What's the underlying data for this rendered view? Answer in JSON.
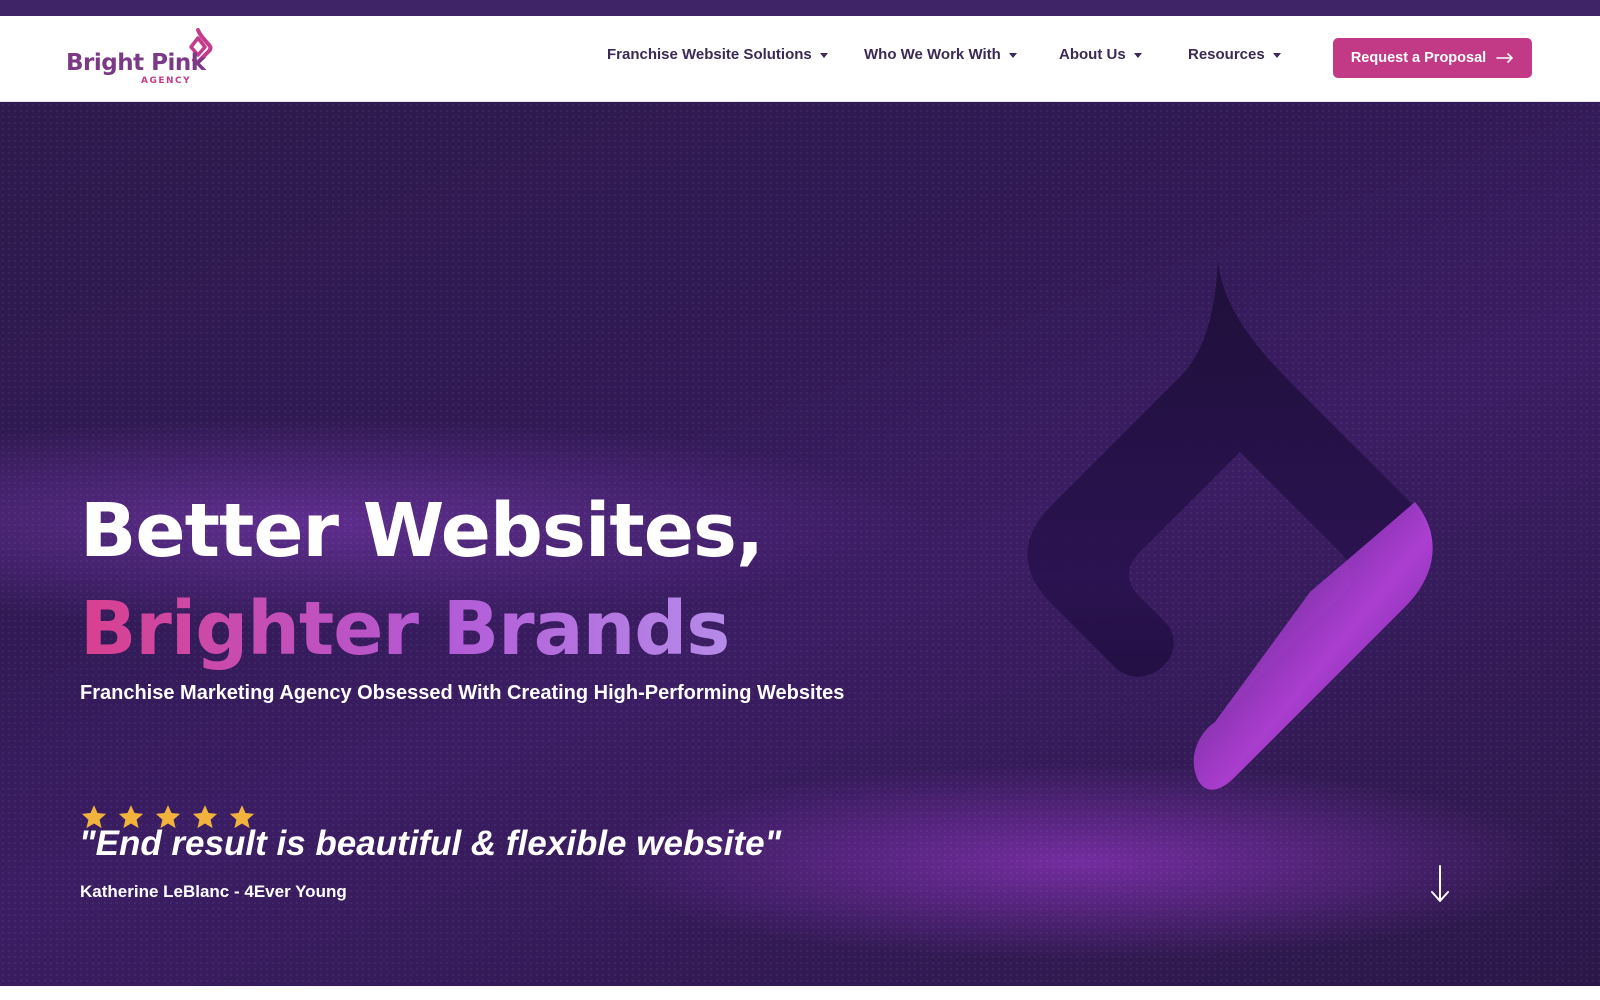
{
  "brand": {
    "name": "Bright Pink",
    "sub": "AGENCY",
    "colors": {
      "primary_purple": "#3f2468",
      "pink": "#c23a86",
      "gold_star": "#f2b33d"
    }
  },
  "nav": {
    "items": [
      {
        "label": "Franchise Website Solutions",
        "icon": "chevron-down-icon"
      },
      {
        "label": "Who We Work With",
        "icon": "chevron-down-icon"
      },
      {
        "label": "About Us",
        "icon": "chevron-down-icon"
      },
      {
        "label": "Resources",
        "icon": "chevron-down-icon"
      }
    ],
    "cta_label": "Request a Proposal",
    "cta_icon": "arrow-right-icon"
  },
  "hero": {
    "headline_line1": "Better Websites,",
    "headline_line2": "Brighter Brands",
    "subheadline": "Franchise Marketing Agency Obsessed With Creating High-Performing Websites",
    "rating_stars": 5,
    "testimonial_quote": "\"End result is beautiful & flexible website\"",
    "testimonial_author": "Katherine LeBlanc - 4Ever Young",
    "scroll_icon": "arrow-down-icon"
  }
}
